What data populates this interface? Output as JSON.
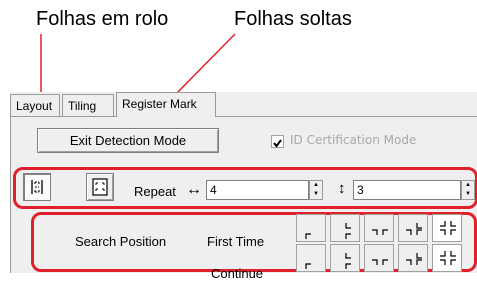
{
  "captions": {
    "left": "Folhas em rolo",
    "right": "Folhas soltas"
  },
  "tabs": [
    {
      "label": "Layout",
      "active": false
    },
    {
      "label": "Tiling",
      "active": false
    },
    {
      "label": "Register Mark",
      "active": true
    }
  ],
  "exit_button": {
    "label": "Exit Detection Mode"
  },
  "id_certification": {
    "label": "ID Certification Mode",
    "checked": true,
    "enabled": false
  },
  "repeat": {
    "label": "Repeat",
    "horizontal_symbol": "↔",
    "horizontal_value": "4",
    "vertical_symbol": "↕",
    "vertical_value": "3"
  },
  "search_position": {
    "label": "Search Position",
    "rows": [
      {
        "label": "First Time"
      },
      {
        "label": "Continue"
      }
    ]
  },
  "colors": {
    "highlight": "#e0202a",
    "panel": "#efefef"
  },
  "icons": [
    "roll-sheet-icon",
    "single-sheet-icon",
    "spin-up-icon",
    "spin-down-icon",
    "corner-mark-icon"
  ]
}
